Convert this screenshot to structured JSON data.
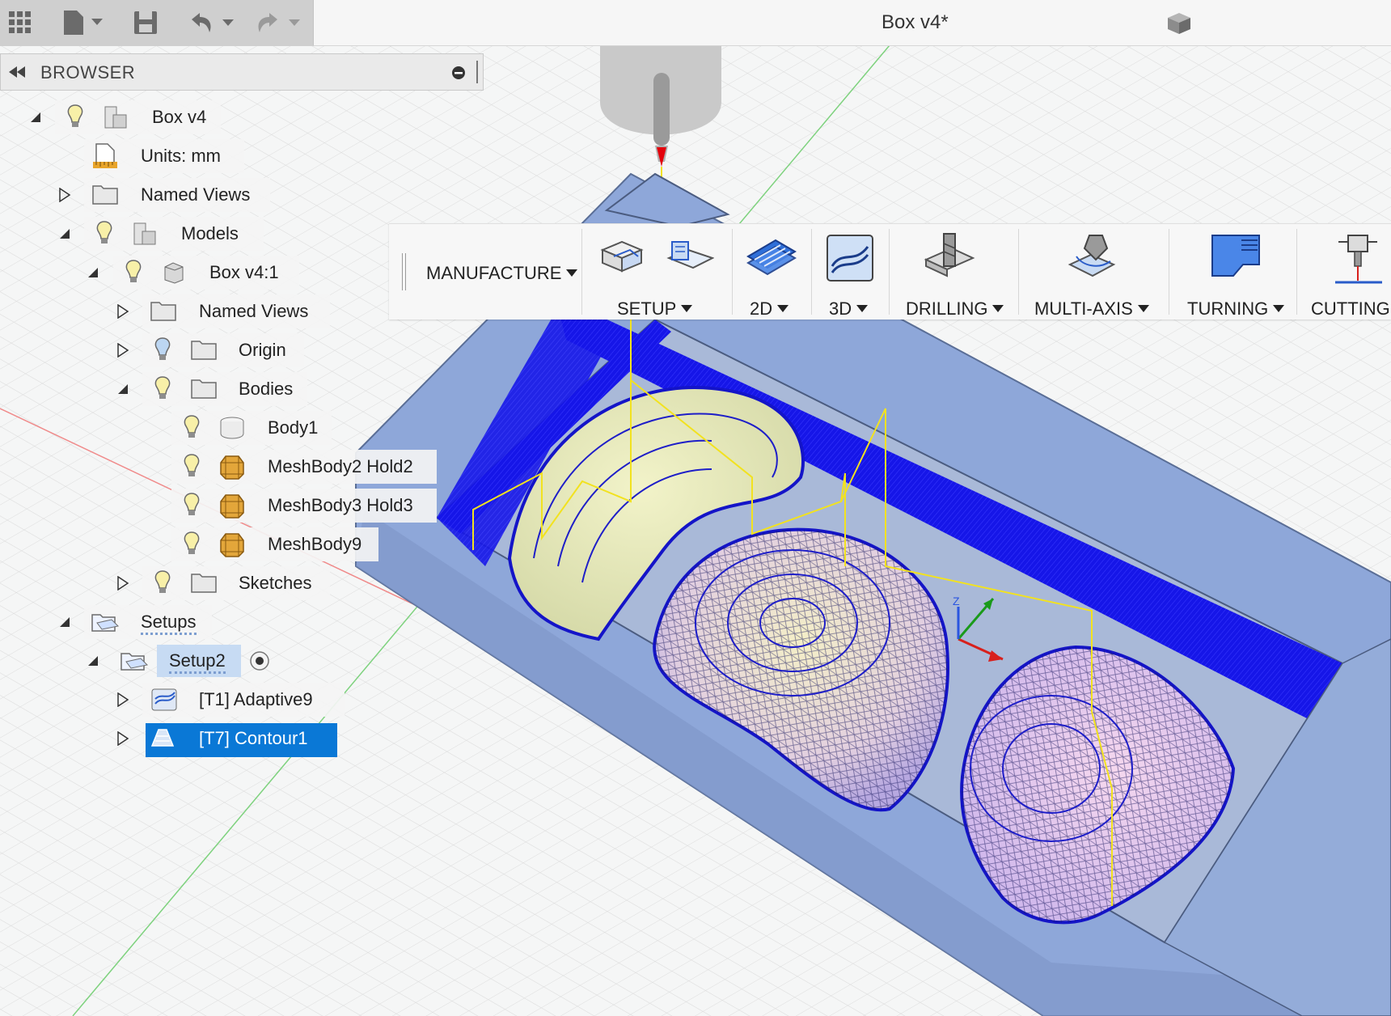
{
  "window": {
    "document_title": "Box v4*"
  },
  "quick_access": {
    "icons": [
      "grid-icon",
      "file-icon",
      "save-icon",
      "undo-icon",
      "redo-icon"
    ]
  },
  "browser": {
    "title": "BROWSER",
    "tree": {
      "root": "Box v4",
      "units": "Units: mm",
      "named_views": "Named Views",
      "models": "Models",
      "component": "Box v4:1",
      "comp_named_views": "Named Views",
      "origin": "Origin",
      "bodies": "Bodies",
      "body1": "Body1",
      "mesh2": "MeshBody2 Hold2",
      "mesh3": "MeshBody3 Hold3",
      "mesh9": "MeshBody9",
      "sketches": "Sketches",
      "setups": "Setups",
      "setup2": "Setup2",
      "op1": "[T1] Adaptive9",
      "op2": "[T7] Contour1"
    }
  },
  "toolbar": {
    "workspace": "MANUFACTURE",
    "groups": {
      "setup": "SETUP",
      "2d": "2D",
      "3d": "3D",
      "drilling": "DRILLING",
      "multiaxis": "MULTI-AXIS",
      "turning": "TURNING",
      "cutting": "CUTTING"
    }
  },
  "colors": {
    "selection": "#0a78d6",
    "toolpath": "#1010d8",
    "stock": "#8fa8d8",
    "link_moves": "#f0e020"
  }
}
